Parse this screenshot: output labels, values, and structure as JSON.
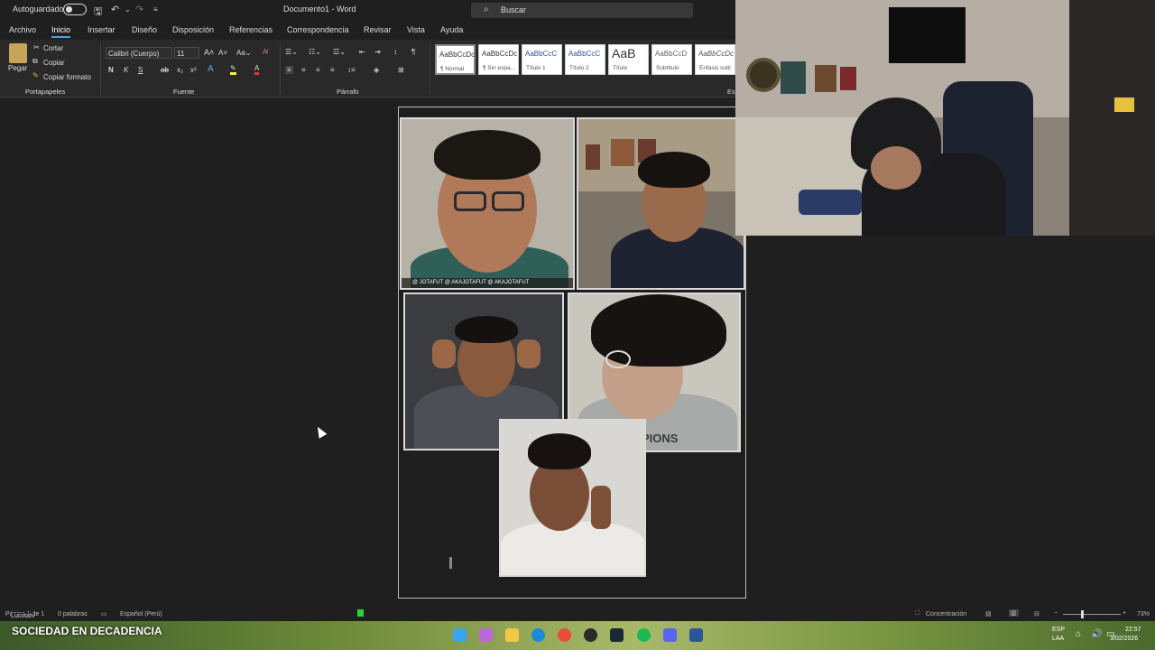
{
  "titlebar": {
    "autosave_label": "Autoguardado",
    "doc_title": "Documento1 - Word",
    "search_placeholder": "Buscar"
  },
  "menu": {
    "tabs": [
      "Archivo",
      "Inicio",
      "Insertar",
      "Diseño",
      "Disposición",
      "Referencias",
      "Correspondencia",
      "Revisar",
      "Vista",
      "Ayuda"
    ],
    "active": "Inicio"
  },
  "ribbon": {
    "clipboard": {
      "paste": "Pegar",
      "cut": "Cortar",
      "copy": "Copiar",
      "format_painter": "Copiar formato",
      "group": "Portapapeles"
    },
    "font": {
      "name": "Calibri (Cuerpo)",
      "size": "11",
      "group": "Fuente",
      "bold": "N",
      "italic": "K",
      "underline": "S"
    },
    "paragraph": {
      "group": "Párrafo"
    },
    "styles": [
      {
        "sample": "AaBbCcDc",
        "name": "¶ Normal"
      },
      {
        "sample": "AaBbCcDc",
        "name": "¶ Sin espa..."
      },
      {
        "sample": "AaBbCcC",
        "name": "Título 1"
      },
      {
        "sample": "AaBbCcC",
        "name": "Título 2"
      },
      {
        "sample": "AaB",
        "name": "Título"
      },
      {
        "sample": "AaBbCcD",
        "name": "Subtítulo"
      },
      {
        "sample": "AaBbCcDc",
        "name": "Énfasis sutil"
      }
    ],
    "styles_group_partial": "Es"
  },
  "collage": {
    "overlay_text": "@ JOTAFUT  @ AKAJOTAFUT  @ AKAJOTAFUT",
    "shirt_text": "PIONS"
  },
  "statusbar": {
    "page": "Página 1 de 1",
    "words": "0 palabras",
    "language": "Español (Perú)",
    "focus": "Concentración",
    "zoom": "73%"
  },
  "stream": {
    "channel_tag": "Lucotatv",
    "caption": "SOCIEDAD EN DECADENCIA"
  },
  "taskbar": {
    "lang_top": "ESP",
    "lang_bottom": "LAA",
    "time": "22:57",
    "date": "3/02/2026"
  },
  "colors": {
    "accent": "#4aa0e6",
    "ribbon_bg": "#292929",
    "app_bg": "#1f1f1f"
  }
}
